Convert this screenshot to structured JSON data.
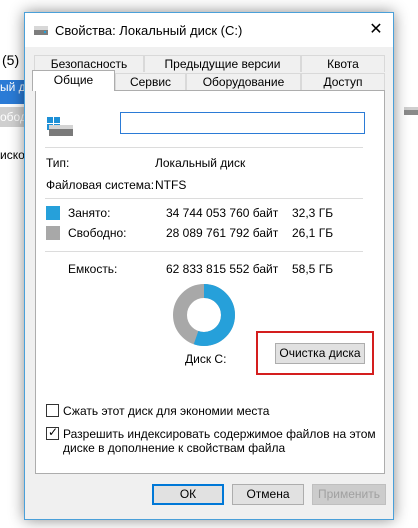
{
  "background": {
    "fragment_count": "(5)",
    "fragment_row1": "ый ди",
    "fragment_row2": "ободн",
    "fragment_row3": "иско"
  },
  "dialog": {
    "title": "Свойства: Локальный диск (C:)",
    "close_glyph": "✕",
    "tabs_row1": [
      "Безопасность",
      "Предыдущие версии",
      "Квота"
    ],
    "tabs_row2": [
      "Общие",
      "Сервис",
      "Оборудование",
      "Доступ"
    ],
    "active_tab": "Общие"
  },
  "general": {
    "name_value": "",
    "type_label": "Тип:",
    "type_value": "Локальный диск",
    "fs_label": "Файловая система:",
    "fs_value": "NTFS",
    "used": {
      "label": "Занято:",
      "bytes": "34 744 053 760 байт",
      "size": "32,3 ГБ"
    },
    "free": {
      "label": "Свободно:",
      "bytes": "28 089 761 792 байт",
      "size": "26,1 ГБ"
    },
    "capacity": {
      "label": "Емкость:",
      "bytes": "62 833 815 552 байт",
      "size": "58,5 ГБ"
    },
    "used_fraction": 0.553,
    "disk_label": "Диск C:",
    "cleanup_button": "Очистка диска",
    "compress_label": "Сжать этот диск для экономии места",
    "compress_checked": false,
    "index_label_line1": "Разрешить индексировать содержимое файлов на этом",
    "index_label_line2": "диске в дополнение к свойствам файла",
    "index_checked": true
  },
  "buttons": {
    "ok": "ОК",
    "cancel": "Отмена",
    "apply": "Применить"
  },
  "colors": {
    "used": "#26a0da",
    "free": "#a8a8a8",
    "accent": "#0078d7",
    "highlight": "#d41e1e"
  }
}
